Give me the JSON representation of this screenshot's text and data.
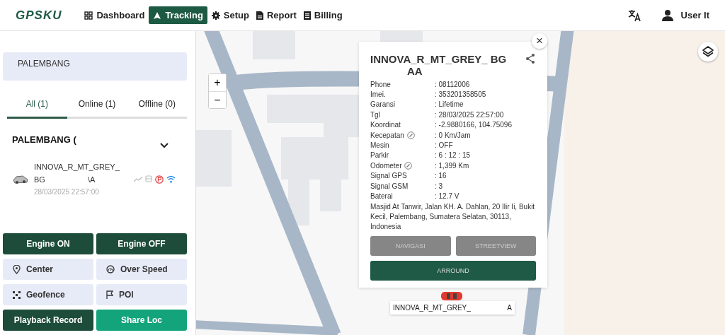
{
  "header": {
    "logo": "GPSKU",
    "nav": [
      {
        "label": "Dashboard",
        "selected": false
      },
      {
        "label": "Tracking",
        "selected": true
      },
      {
        "label": "Setup",
        "selected": false
      },
      {
        "label": "Report",
        "selected": false
      },
      {
        "label": "Billing",
        "selected": false
      }
    ],
    "user": "User It"
  },
  "sidebar": {
    "search": {
      "value": "PALEMBANG"
    },
    "tabs": [
      {
        "label": "All (1)",
        "selected": true
      },
      {
        "label": "Online (1)",
        "selected": false
      },
      {
        "label": "Offline (0)",
        "selected": false
      }
    ],
    "group": {
      "name": "PALEMBANG (",
      "expanded": true
    },
    "vehicles": [
      {
        "name": "INNOVA_R_MT_GREY_",
        "plate": "BG",
        "plate_tail": "\\A",
        "time": "28/03/2025 22:57:00"
      }
    ],
    "actions": [
      {
        "label": "Engine ON",
        "kind": "solid"
      },
      {
        "label": "Engine OFF",
        "kind": "solid"
      },
      {
        "label": "Center",
        "kind": "light"
      },
      {
        "label": "Over Speed",
        "kind": "light"
      },
      {
        "label": "Geofence",
        "kind": "light"
      },
      {
        "label": "POI",
        "kind": "light"
      },
      {
        "label": "Playback Record",
        "kind": "solid"
      },
      {
        "label": "Share Loc",
        "kind": "accent"
      }
    ]
  },
  "popup": {
    "title": "INNOVA_R_MT_GREY_ BG",
    "title_tail": "AA",
    "fields": [
      {
        "label": "Phone",
        "value": ": 08112006",
        "editable": false
      },
      {
        "label": "Imei.",
        "value": ": 353201358505",
        "editable": false
      },
      {
        "label": "Garansi",
        "value": ": Lifetime",
        "editable": false
      },
      {
        "label": "Tgl",
        "value": ": 28/03/2025 22:57:00",
        "editable": false
      },
      {
        "label": "Koordinat",
        "value": ": -2.9880166, 104.75096",
        "editable": false
      },
      {
        "label": "Kecepatan",
        "value": ": 0 Km/Jam",
        "editable": true
      },
      {
        "label": "Mesin",
        "value": ": OFF",
        "editable": false
      },
      {
        "label": "Parkir",
        "value": ": 6 : 12 : 15",
        "editable": false
      },
      {
        "label": "Odometer",
        "value": ": 1,399 Km",
        "editable": true
      },
      {
        "label": "Signal GPS",
        "value": ": 16",
        "editable": false
      },
      {
        "label": "Signal GSM",
        "value": ": 3",
        "editable": false
      },
      {
        "label": "Baterai",
        "value": ": 12.7 V",
        "editable": false
      }
    ],
    "address": "Masjid At Tanwir, Jalan KH. A. Dahlan, 20 Ilir Ii, Bukit Kecil, Palembang, Sumatera Selatan, 30113, Indonesia",
    "buttons": [
      {
        "label": "NAVIGASI",
        "disabled": true
      },
      {
        "label": "STREETVIEW",
        "disabled": true
      },
      {
        "label": "ARROUND",
        "disabled": false
      }
    ]
  },
  "marker": {
    "label": "INNOVA_R_MT_GREY_",
    "label_tail": "A"
  },
  "zoom": {
    "in": "+",
    "out": "−"
  },
  "close": "×"
}
